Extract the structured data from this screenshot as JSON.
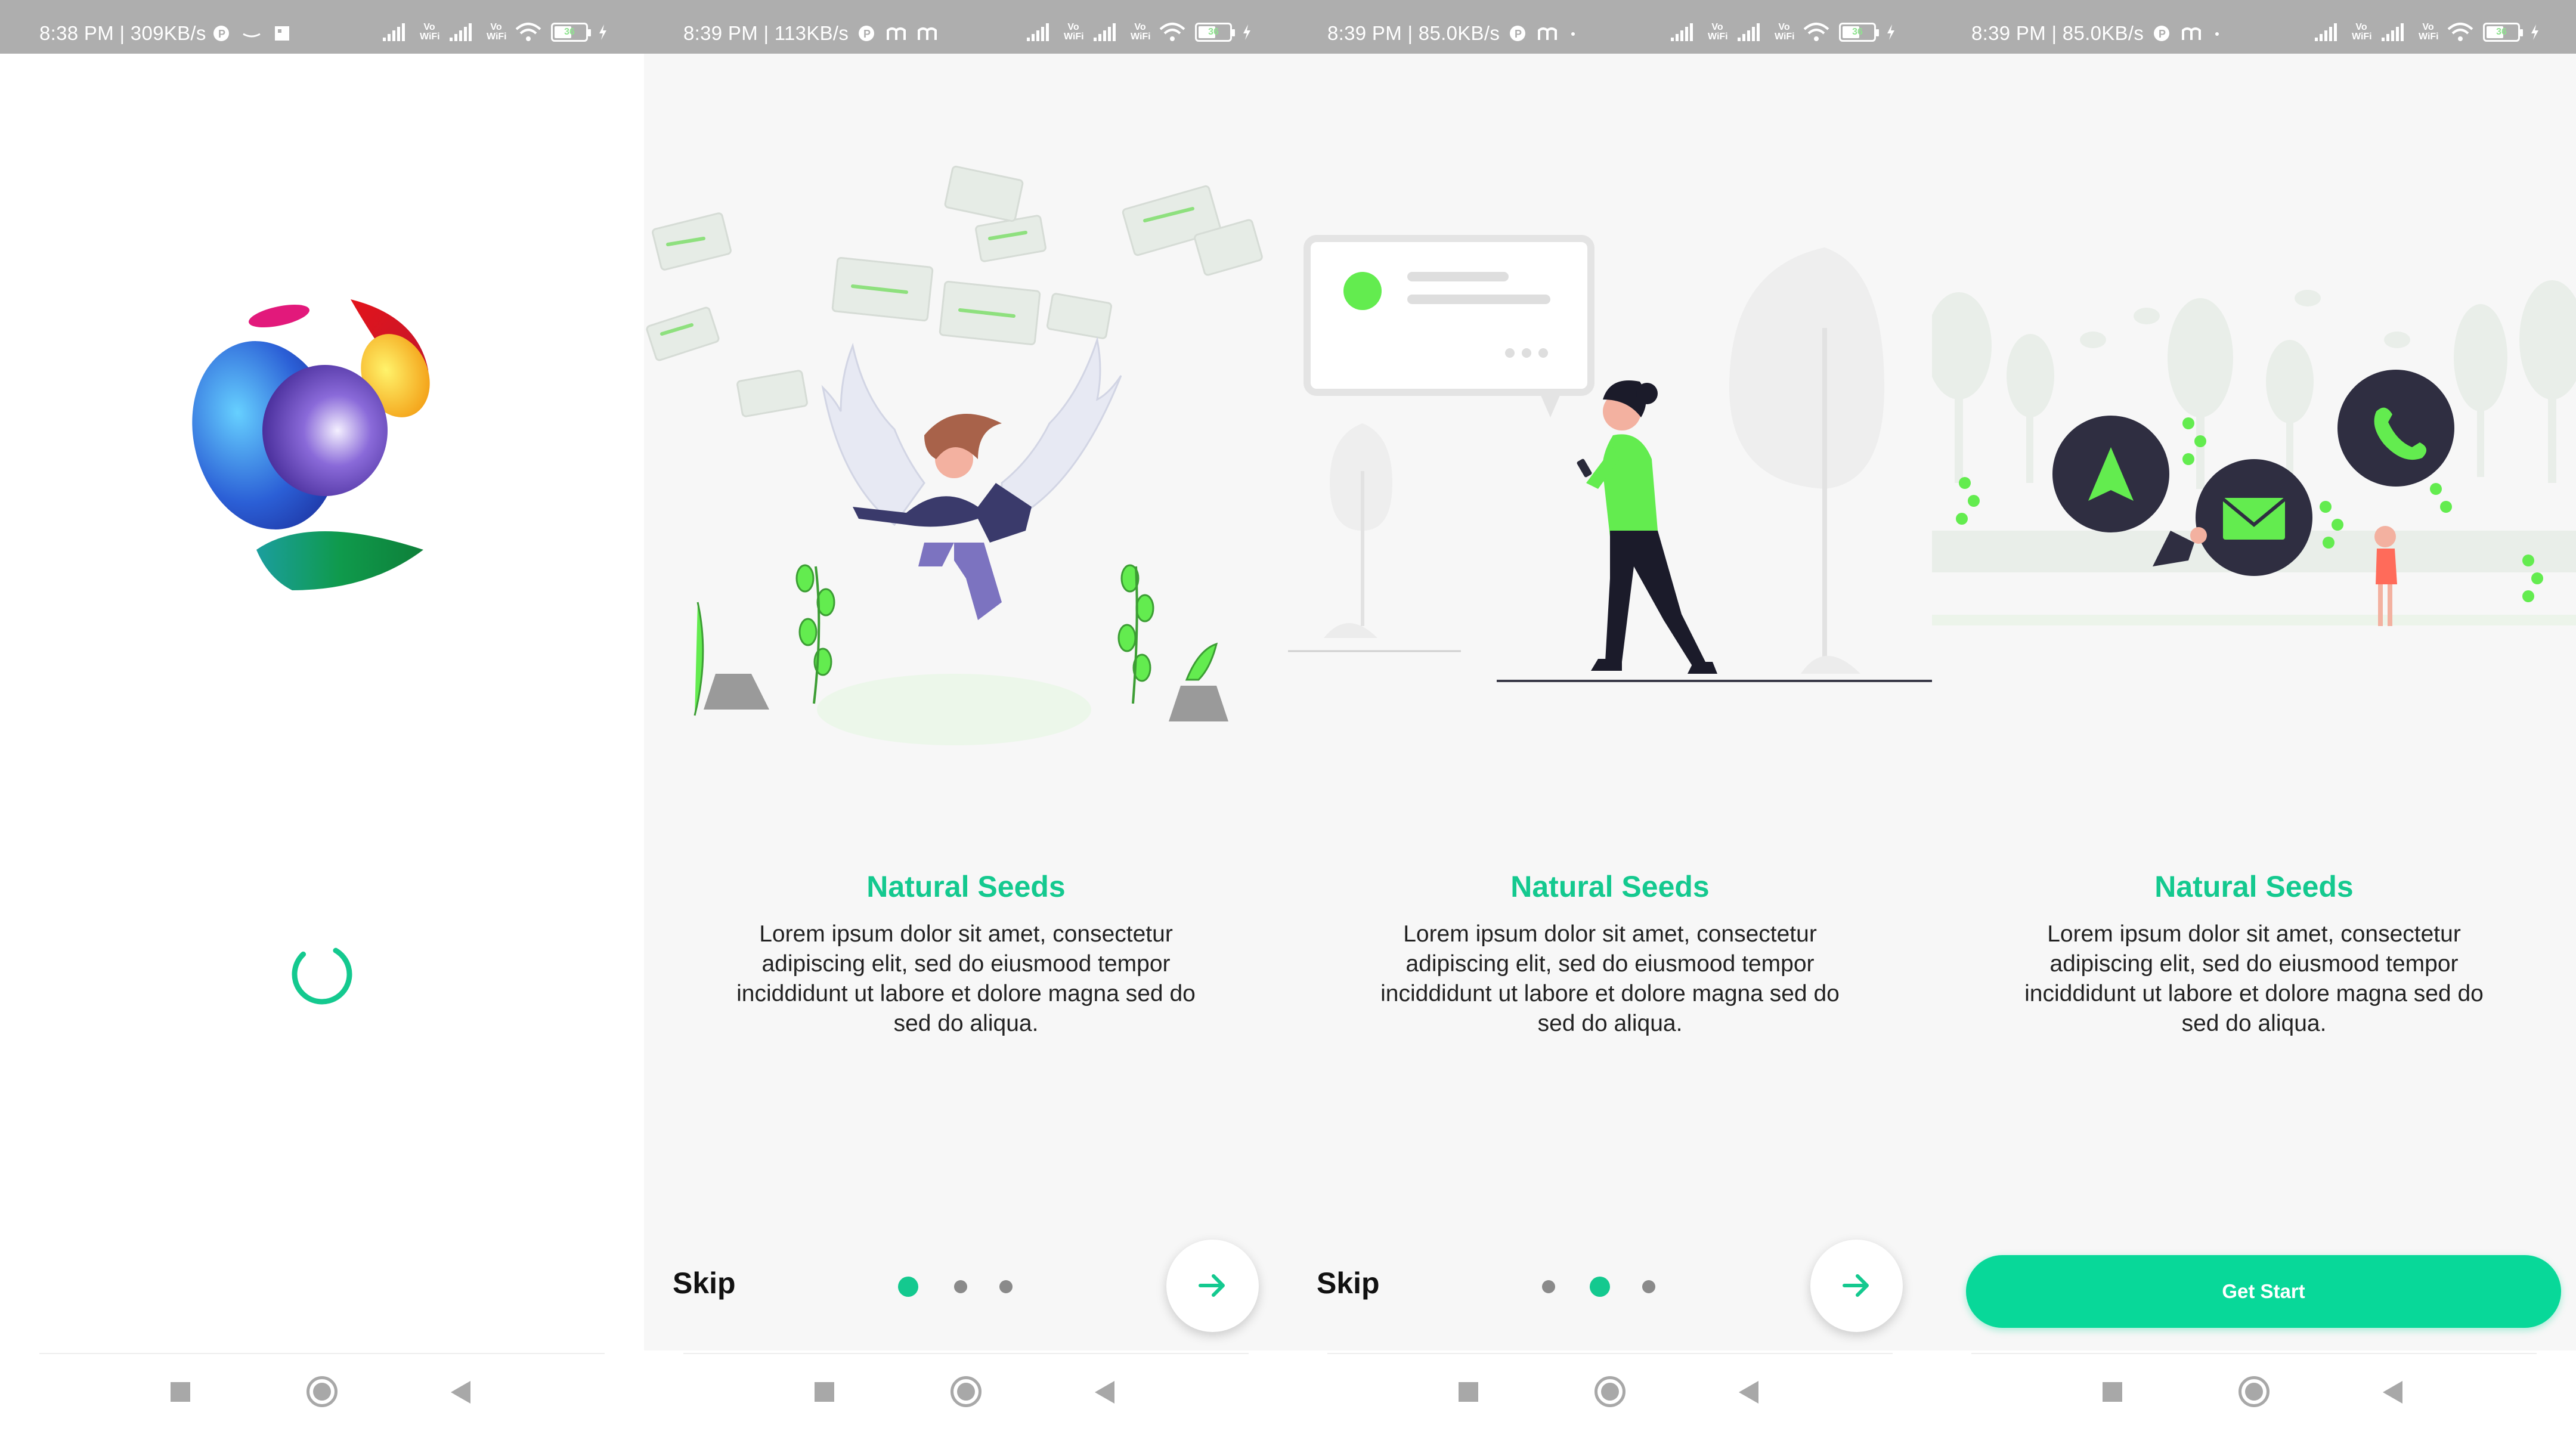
{
  "colors": {
    "accent": "#14c98f",
    "button": "#08d899",
    "statusbar": "#aeaeae",
    "figure_green": "#63ec4f"
  },
  "screens": [
    {
      "status": {
        "time": "8:38 PM | 309KB/s"
      },
      "loader": {
        "icon": "loading-spinner"
      }
    },
    {
      "status": {
        "time": "8:39 PM | 113KB/s"
      },
      "title": "Natural Seeds",
      "body": "Lorem ipsum dolor sit amet, consectetur adipiscing elit, sed do eiusmood tempor inciddidunt ut labore et dolore magna sed do sed do aliqua.",
      "skip": "Skip",
      "page_index": 1,
      "page_count": 3
    },
    {
      "status": {
        "time": "8:39 PM | 85.0KB/s"
      },
      "title": "Natural Seeds",
      "body": "Lorem ipsum dolor sit amet, consectetur adipiscing elit, sed do eiusmood tempor inciddidunt ut labore et dolore magna sed do sed do aliqua.",
      "skip": "Skip",
      "page_index": 2,
      "page_count": 3
    },
    {
      "status": {
        "time": "8:39 PM | 85.0KB/s"
      },
      "title": "Natural Seeds",
      "body": "Lorem ipsum dolor sit amet, consectetur adipiscing elit, sed do eiusmood tempor inciddidunt ut labore et dolore magna sed do sed do aliqua.",
      "button": "Get Start"
    }
  ],
  "statusbar_common": {
    "vo_label": "Vo",
    "wifi_label": "WiFi",
    "battery": "36"
  }
}
